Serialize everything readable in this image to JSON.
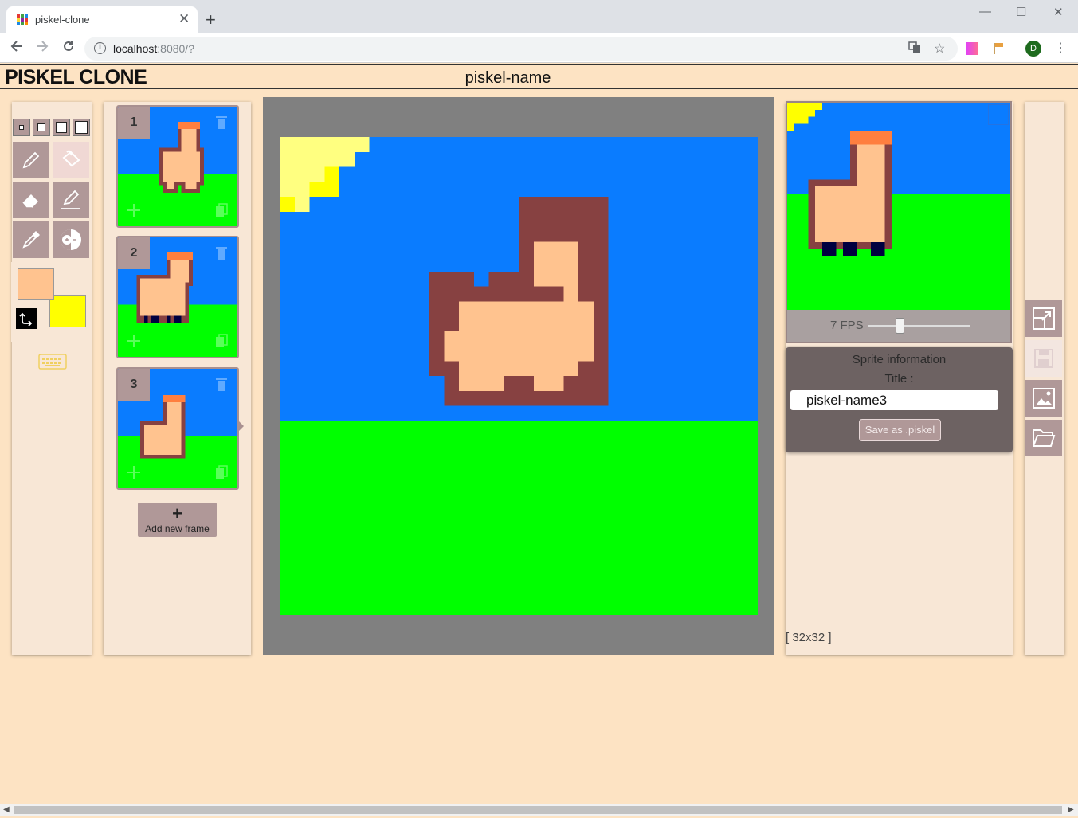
{
  "browser": {
    "tab_title": "piskel-clone",
    "tab_close": "✕",
    "new_tab": "+",
    "url_host": "localhost",
    "url_rest": ":8080/?",
    "avatar_letter": "D",
    "window_controls": [
      "minimize-icon",
      "maximize-icon",
      "close-icon"
    ]
  },
  "header": {
    "logo": "PISKEL CLONE",
    "piskel_name": "piskel-name"
  },
  "tools": {
    "pen_sizes": [
      1,
      2,
      3,
      4
    ],
    "items": [
      "pen-tool",
      "paint-bucket-tool",
      "eraser-tool",
      "stroke-tool",
      "color-picker-tool",
      "lighten-tool"
    ],
    "primary_color": "#ffc38f",
    "secondary_color": "#ffff00"
  },
  "frames": {
    "items": [
      {
        "number": "1"
      },
      {
        "number": "2"
      },
      {
        "number": "3"
      }
    ],
    "add_label": "Add new frame",
    "add_plus": "+"
  },
  "preview": {
    "fps_label": "7 FPS",
    "fps_value": 7
  },
  "sprite_info": {
    "heading": "Sprite information",
    "title_label": "Title :",
    "title_value": "piskel-name3",
    "save_label": "Save as .piskel"
  },
  "size_label": "[ 32x32 ]",
  "colors": {
    "sky": "#0a7cff",
    "grass": "#00ff00",
    "llama_body": "#ffc38f",
    "llama_outline": "#874141",
    "llama_hair": "#ff7f3f",
    "sun": "#ffff00",
    "panel": "#f8e7d6",
    "button": "#b09898",
    "page_bg": "#fde3c3"
  },
  "side_actions": [
    "resize-icon",
    "save-icon",
    "export-image-icon",
    "open-folder-icon"
  ]
}
